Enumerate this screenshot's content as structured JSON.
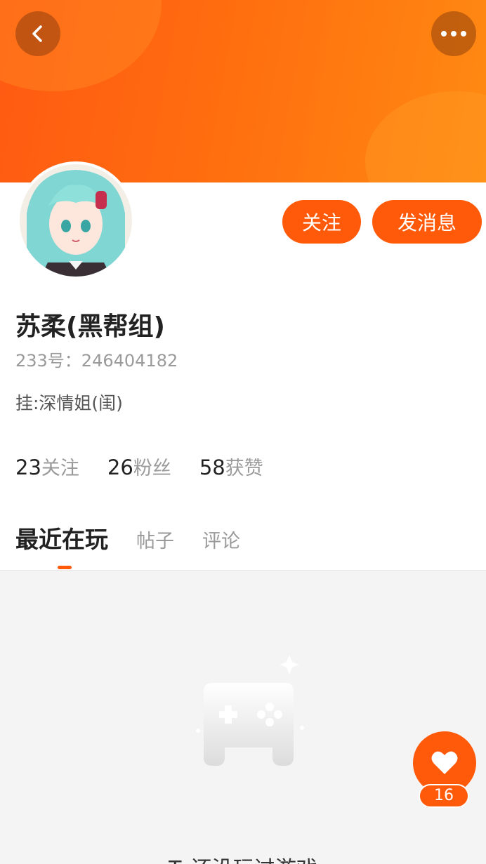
{
  "header": {
    "back_icon": "chevron-left-icon",
    "more_icon": "more-dots-icon",
    "banner_color": "#ff6a10"
  },
  "profile": {
    "name": "苏柔(黑帮组)",
    "id_text": "233号：246404182",
    "status": "挂:深情姐(闺)",
    "avatar": "anime-avatar"
  },
  "actions": {
    "follow_label": "关注",
    "message_label": "发消息"
  },
  "stats": [
    {
      "count": "23",
      "label": "关注"
    },
    {
      "count": "26",
      "label": "粉丝"
    },
    {
      "count": "58",
      "label": "获赞"
    }
  ],
  "tabs": [
    {
      "label": "最近在玩",
      "active": true
    },
    {
      "label": "帖子",
      "active": false
    },
    {
      "label": "评论",
      "active": false
    }
  ],
  "empty_state": {
    "icon": "gamepad-icon",
    "text": "Ta还没玩过游戏"
  },
  "like": {
    "icon": "heart-icon",
    "count": "16"
  },
  "colors": {
    "accent": "#ff5a0a",
    "muted_text": "#9a9a9a"
  }
}
